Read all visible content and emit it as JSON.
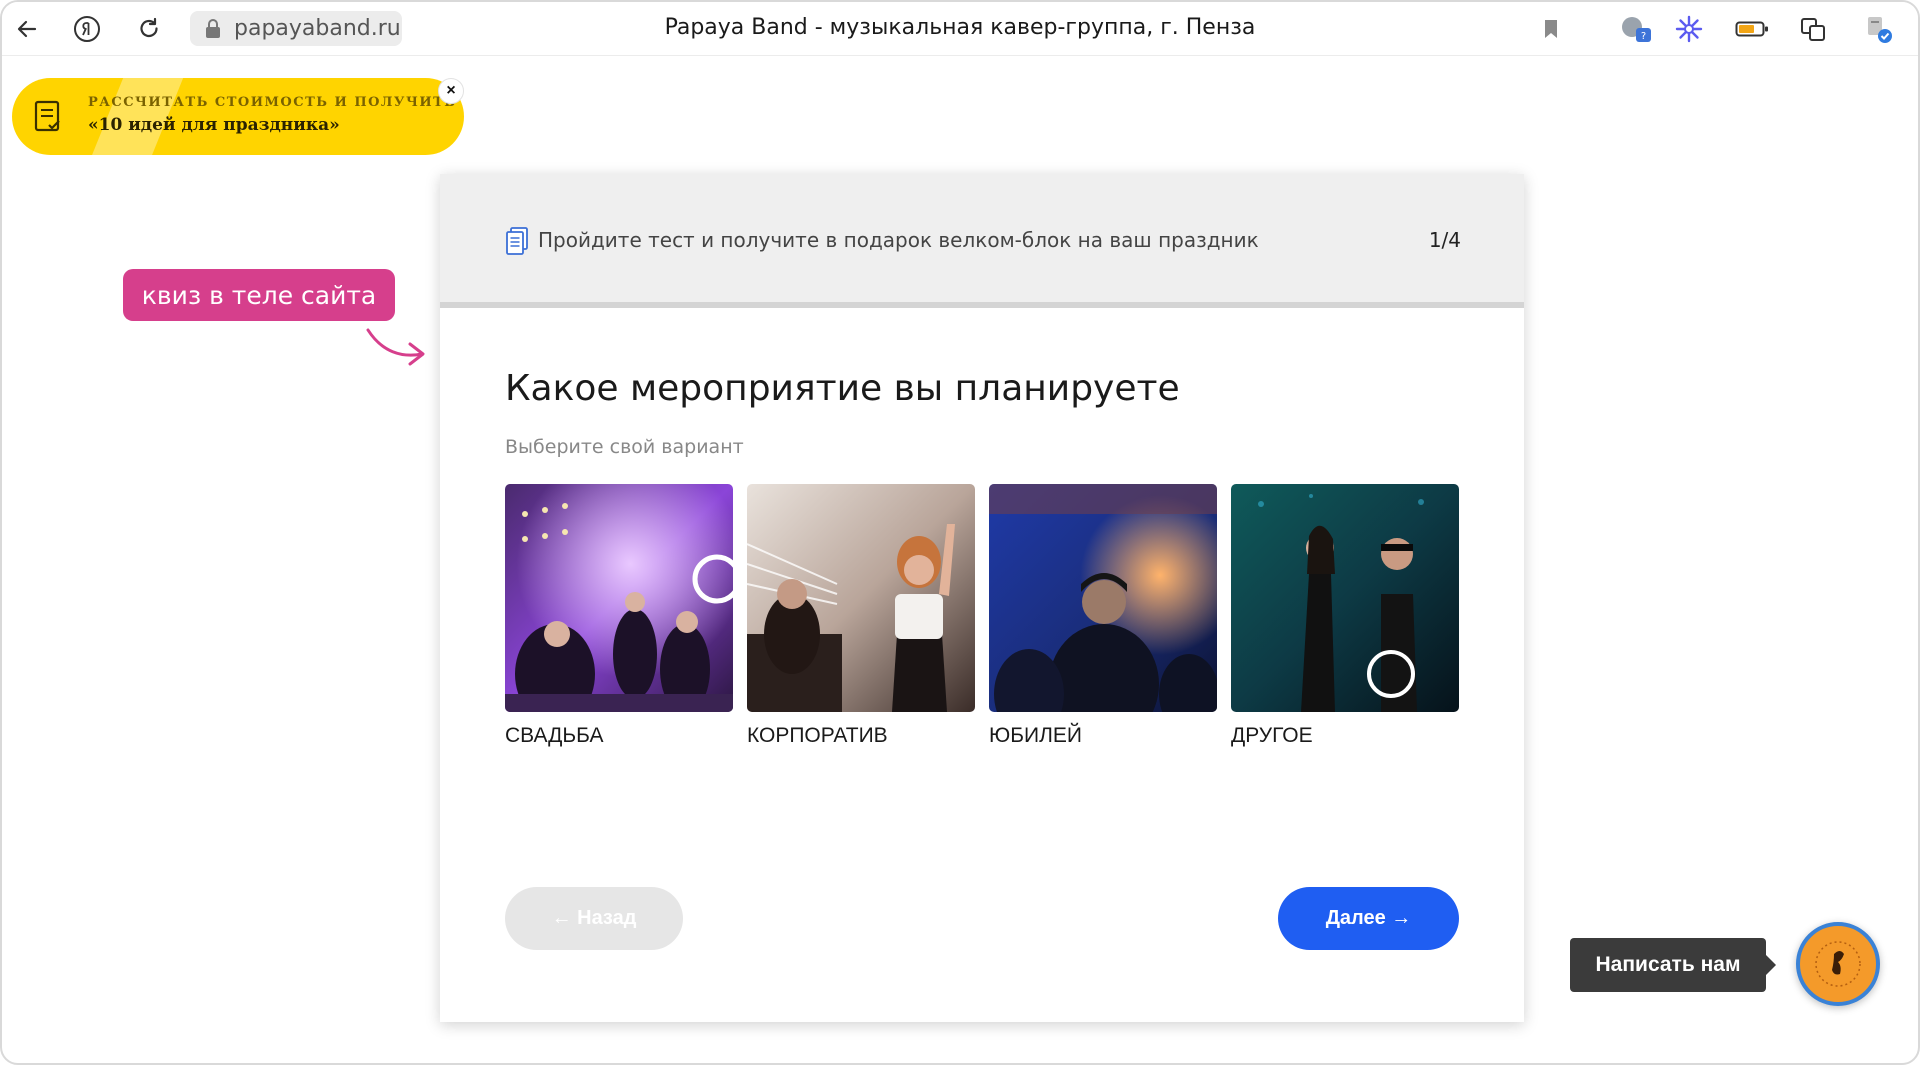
{
  "browser": {
    "url": "papayaband.ru",
    "tab_title": "Papaya Band - музыкальная кавер-группа, г. Пенза",
    "icons": [
      "back-icon",
      "yandex-icon",
      "reload-icon",
      "lock-icon",
      "bookmark-icon",
      "translate-icon",
      "snowflake-icon",
      "battery-icon",
      "screenshot-icon",
      "downloads-icon"
    ]
  },
  "promo": {
    "line1": "РАССЧИТАТЬ СТОИМОСТЬ И ПОЛУЧИТЬ",
    "line2": "«10 идей для праздника»",
    "close": "×"
  },
  "annotation": {
    "label": "квиз в теле сайта"
  },
  "quiz": {
    "header_text": "Пройдите тест и получите в подарок велком-блок на ваш праздник",
    "step": "1/4",
    "title": "Какое мероприятие вы планируете",
    "subtitle": "Выберите свой вариант",
    "options": [
      {
        "label": "СВАДЬБА"
      },
      {
        "label": "КОРПОРАТИВ"
      },
      {
        "label": "ЮБИЛЕЙ"
      },
      {
        "label": "ДРУГОЕ"
      }
    ],
    "back_label": "← Назад",
    "next_label": "Далее →"
  },
  "chat": {
    "label": "Написать нам"
  },
  "colors": {
    "promo": "#ffd400",
    "annotation": "#d63f8c",
    "next_button": "#1f5ef2",
    "chat_badge": "#f49a2a"
  }
}
